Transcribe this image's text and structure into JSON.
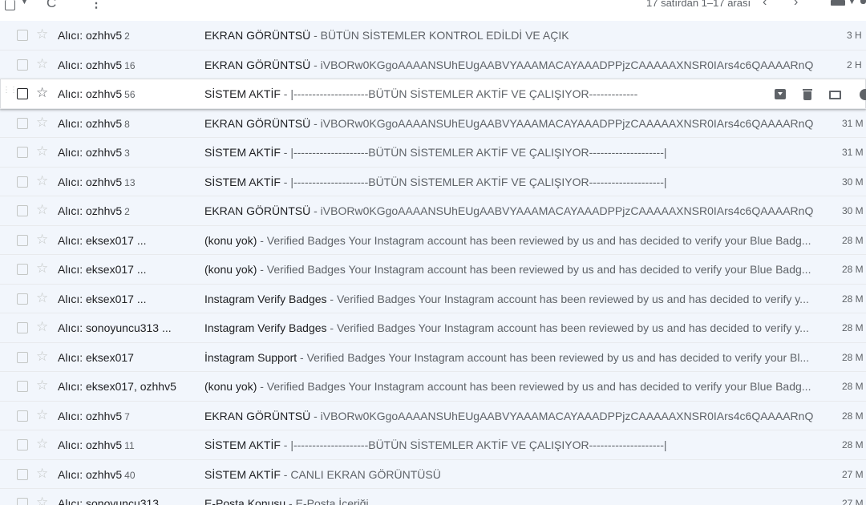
{
  "toolbar": {
    "count_text": "17 satırdan 1–17 arası",
    "prev_icon": "‹",
    "next_icon": "›",
    "refresh_icon": "C",
    "more_icon": "⋮"
  },
  "icons": {
    "select_all": "checkbox-icon",
    "refresh": "refresh-icon",
    "more": "more-vert-icon",
    "prev": "chevron-left-icon",
    "next": "chevron-right-icon",
    "input_tools": "keyboard-icon",
    "settings": "settings-icon",
    "star": "star-icon",
    "archive": "archive-icon",
    "delete": "trash-icon",
    "mark_read": "mark-read-icon",
    "snooze": "clock-icon"
  },
  "colors": {
    "row_bg": "#f2f6fc",
    "row_hover_bg": "#ffffff",
    "text": "#202124",
    "muted": "#5f6368"
  },
  "emails": [
    {
      "from": "Alıcı: ozhhv5",
      "count": "2",
      "subject": "EKRAN GÖRÜNTSÜ",
      "snippet": " - BÜTÜN SİSTEMLER KONTROL EDİLDİ VE AÇIK",
      "date": "3 H"
    },
    {
      "from": "Alıcı: ozhhv5",
      "count": "16",
      "subject": "EKRAN GÖRÜNTSÜ",
      "snippet": " - iVBORw0KGgoAAAANSUhEUgAABVYAAAMACAYAAADPPjzCAAAAAXNSR0IArs4c6QAAAARnQU1B...",
      "date": "2 H"
    },
    {
      "from": "Alıcı: ozhhv5",
      "count": "56",
      "subject": "SİSTEM AKTİF",
      "snippet": " - |--------------------BÜTÜN SİSTEMLER AKTİF VE ÇALIŞIYOR--------------------|",
      "date": "",
      "hover": true
    },
    {
      "from": "Alıcı: ozhhv5",
      "count": "8",
      "subject": "EKRAN GÖRÜNTSÜ",
      "snippet": " - iVBORw0KGgoAAAANSUhEUgAABVYAAAMACAYAAADPPjzCAAAAAXNSR0IArs4c6QAAAARnQU1B...",
      "date": "31 M"
    },
    {
      "from": "Alıcı: ozhhv5",
      "count": "3",
      "subject": "SİSTEM AKTİF",
      "snippet": " - |--------------------BÜTÜN SİSTEMLER AKTİF VE ÇALIŞIYOR--------------------|",
      "date": "31 M"
    },
    {
      "from": "Alıcı: ozhhv5",
      "count": "13",
      "subject": "SİSTEM AKTİF",
      "snippet": " - |--------------------BÜTÜN SİSTEMLER AKTİF VE ÇALIŞIYOR--------------------|",
      "date": "30 M"
    },
    {
      "from": "Alıcı: ozhhv5",
      "count": "2",
      "subject": "EKRAN GÖRÜNTSÜ",
      "snippet": " - iVBORw0KGgoAAAANSUhEUgAABVYAAAMACAYAAADPPjzCAAAAAXNSR0IArs4c6QAAAARnQU1B...",
      "date": "30 M"
    },
    {
      "from": "Alıcı: eksex017 ...",
      "count": "",
      "subject": "(konu yok)",
      "snippet": " - Verified Badges Your Instagram account has been reviewed by us and has decided to verify your Blue Badg...",
      "date": "28 M"
    },
    {
      "from": "Alıcı: eksex017 ...",
      "count": "",
      "subject": "(konu yok)",
      "snippet": " - Verified Badges Your Instagram account has been reviewed by us and has decided to verify your Blue Badg...",
      "date": "28 M"
    },
    {
      "from": "Alıcı: eksex017 ...",
      "count": "",
      "subject": "Instagram Verify Badges",
      "snippet": " - Verified Badges Your Instagram account has been reviewed by us and has decided to verify y...",
      "date": "28 M"
    },
    {
      "from": "Alıcı: sonoyuncu313 ...",
      "count": "",
      "subject": "Instagram Verify Badges",
      "snippet": " - Verified Badges Your Instagram account has been reviewed by us and has decided to verify y...",
      "date": "28 M"
    },
    {
      "from": "Alıcı: eksex017",
      "count": "",
      "subject": "İnstagram Support",
      "snippet": " - Verified Badges Your Instagram account has been reviewed by us and has decided to verify your Bl...",
      "date": "28 M"
    },
    {
      "from": "Alıcı: eksex017, ozhhv5",
      "count": "",
      "subject": "(konu yok)",
      "snippet": " - Verified Badges Your Instagram account has been reviewed by us and has decided to verify your Blue Badg...",
      "date": "28 M"
    },
    {
      "from": "Alıcı: ozhhv5",
      "count": "7",
      "subject": "EKRAN GÖRÜNTSÜ",
      "snippet": " - iVBORw0KGgoAAAANSUhEUgAABVYAAAMACAYAAADPPjzCAAAAAXNSR0IArs4c6QAAAARnQU1B...",
      "date": "28 M"
    },
    {
      "from": "Alıcı: ozhhv5",
      "count": "11",
      "subject": "SİSTEM AKTİF",
      "snippet": " - |--------------------BÜTÜN SİSTEMLER AKTİF VE ÇALIŞIYOR--------------------|",
      "date": "28 M"
    },
    {
      "from": "Alıcı: ozhhv5",
      "count": "40",
      "subject": "SİSTEM AKTİF",
      "snippet": " - CANLI EKRAN GÖRÜNTÜSÜ",
      "date": "27 M"
    },
    {
      "from": "Alıcı: sonoyuncu313",
      "count": "",
      "subject": "E-Posta Konusu",
      "snippet": " - E-Posta İçeriği",
      "date": "27 M"
    }
  ]
}
